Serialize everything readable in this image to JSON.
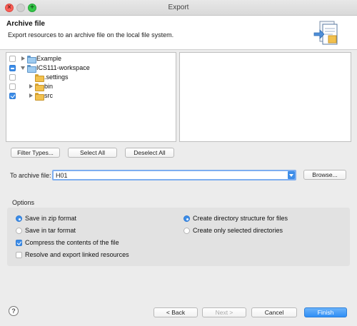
{
  "window": {
    "title": "Export"
  },
  "header": {
    "title": "Archive file",
    "description": "Export resources to an archive file on the local file system."
  },
  "tree": [
    {
      "label": "Example",
      "check": "none",
      "expanded": false,
      "kind": "project"
    },
    {
      "label": "ICS111-workspace",
      "check": "partial",
      "expanded": true,
      "kind": "project"
    },
    {
      "label": ".settings",
      "check": "none",
      "kind": "folder"
    },
    {
      "label": "bin",
      "check": "none",
      "expanded": false,
      "kind": "folder"
    },
    {
      "label": "src",
      "check": "checked",
      "expanded": false,
      "kind": "folder"
    }
  ],
  "buttons": {
    "filter_types": "Filter Types...",
    "select_all": "Select All",
    "deselect_all": "Deselect All",
    "browse": "Browse...",
    "back": "< Back",
    "next": "Next >",
    "cancel": "Cancel",
    "finish": "Finish"
  },
  "archive": {
    "label": "To archive file:",
    "value": "H01"
  },
  "options": {
    "title": "Options",
    "zip": "Save in zip format",
    "tar": "Save in tar format",
    "compress": "Compress the contents of the file",
    "resolve": "Resolve and export linked resources",
    "create_dirs": "Create directory structure for files",
    "create_selected": "Create only selected directories",
    "format_selected": "zip",
    "structure_selected": "create_dirs",
    "compress_checked": true,
    "resolve_checked": false
  },
  "help_icon": "?",
  "colors": {
    "accent": "#3d8de8",
    "folder": "#f2c14e"
  }
}
